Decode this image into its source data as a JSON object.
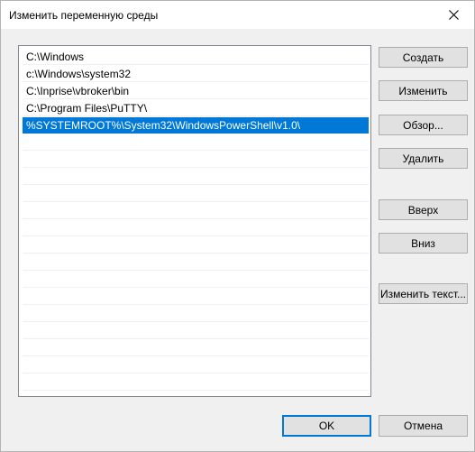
{
  "dialog": {
    "title": "Изменить переменную среды"
  },
  "list": {
    "items": [
      "C:\\Windows",
      "c:\\Windows\\system32",
      "C:\\Inprise\\vbroker\\bin",
      "C:\\Program Files\\PuTTY\\",
      "%SYSTEMROOT%\\System32\\WindowsPowerShell\\v1.0\\"
    ],
    "selected_index": 4
  },
  "buttons": {
    "new": "Создать",
    "edit": "Изменить",
    "browse": "Обзор...",
    "delete": "Удалить",
    "up": "Вверх",
    "down": "Вниз",
    "edit_text": "Изменить текст...",
    "ok": "OK",
    "cancel": "Отмена"
  },
  "colors": {
    "selection": "#0078d7",
    "default_button_border": "#0078d7"
  }
}
